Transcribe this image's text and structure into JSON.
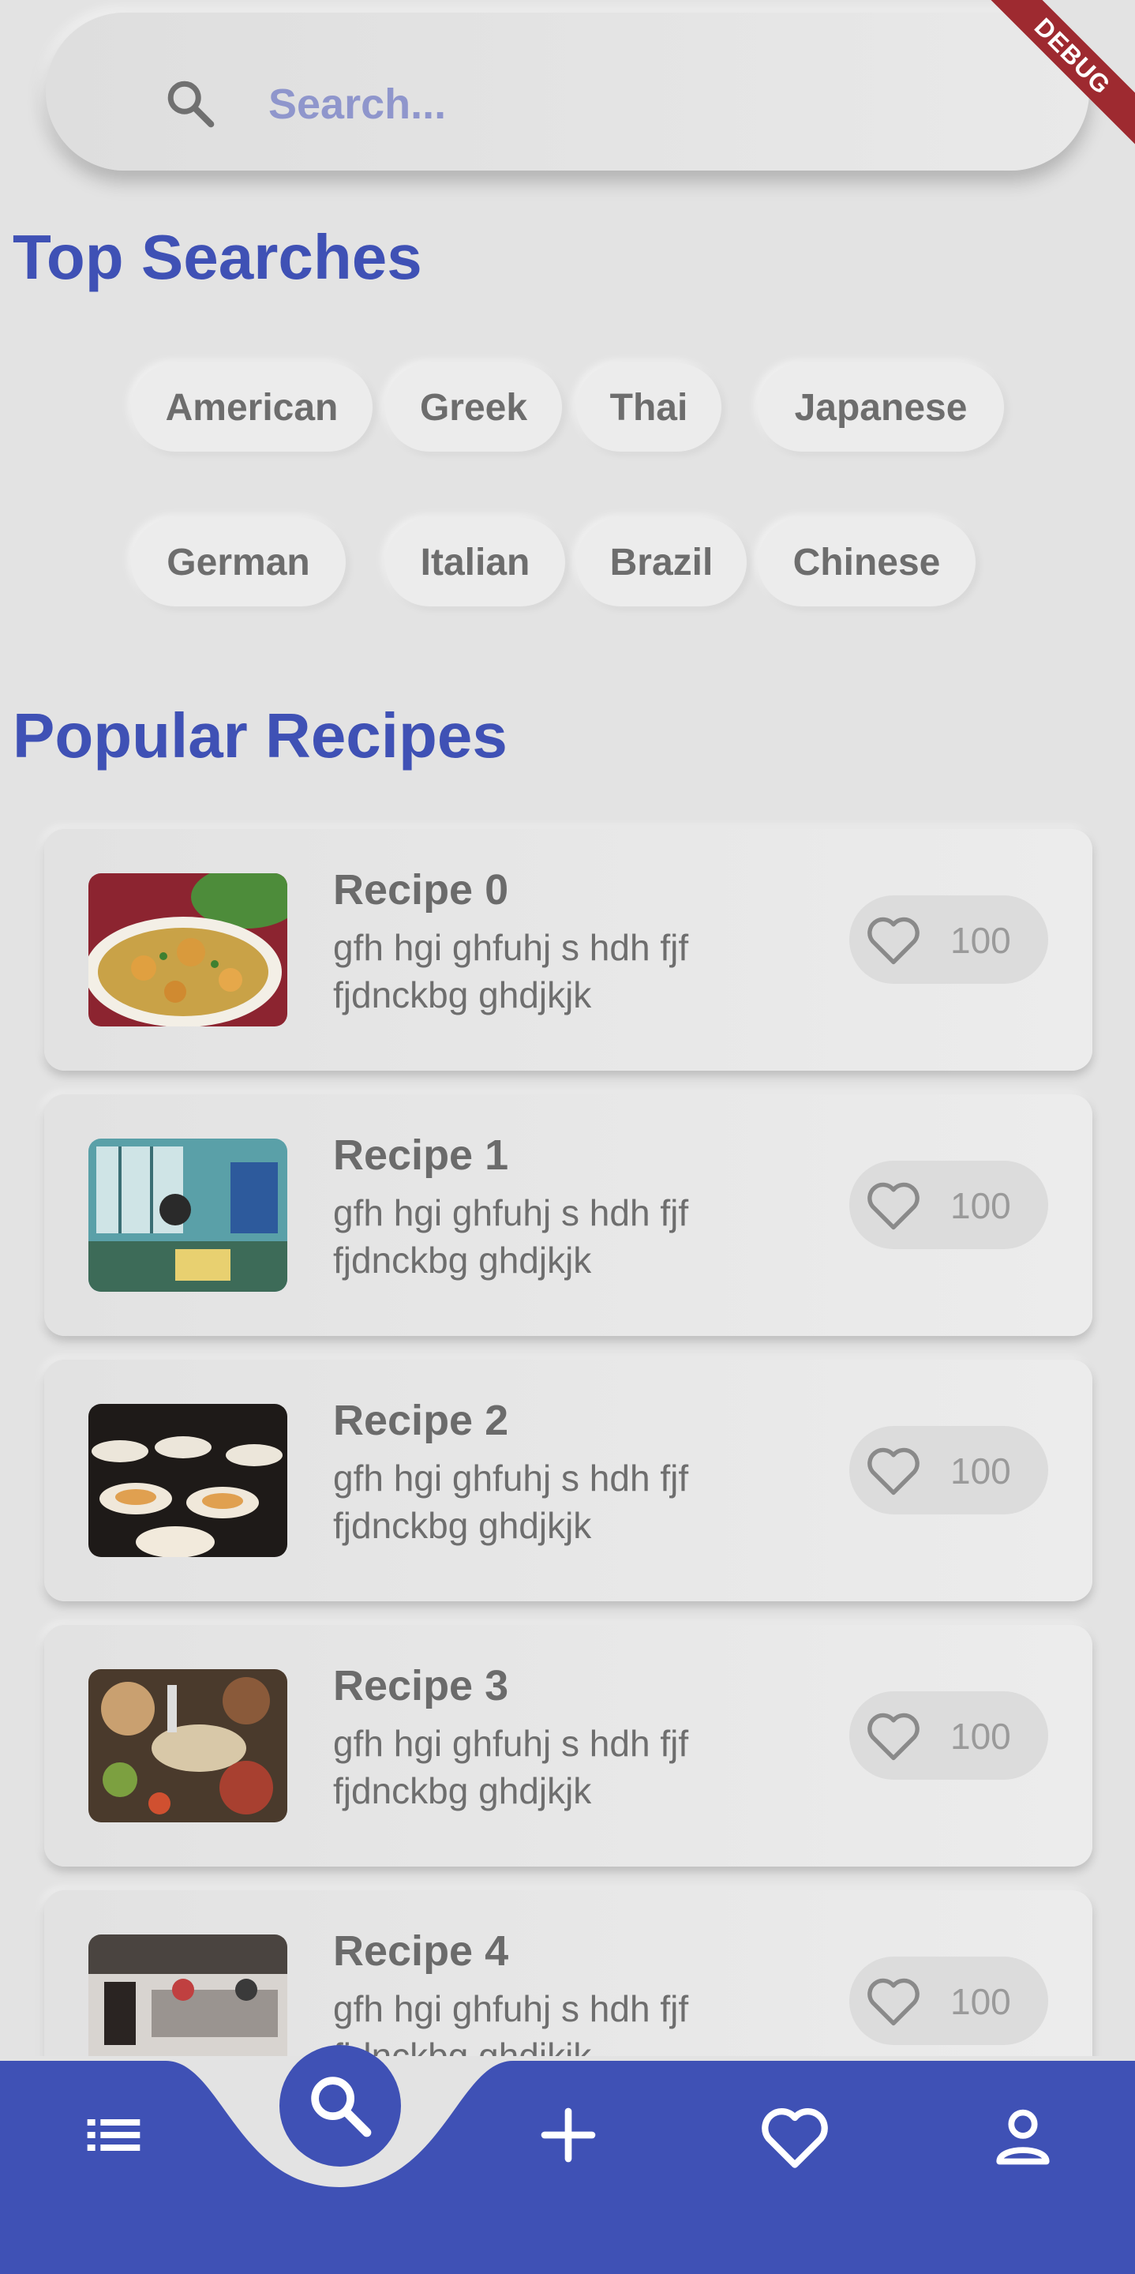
{
  "search": {
    "placeholder": "Search..."
  },
  "debug_label": "DEBUG",
  "top_searches": {
    "title": "Top Searches",
    "tags": [
      "American",
      "Greek",
      "Thai",
      "Japanese",
      "German",
      "Italian",
      "Brazil",
      "Chinese"
    ]
  },
  "popular": {
    "title": "Popular Recipes",
    "recipes": [
      {
        "title": "Recipe 0",
        "description": "gfh hgi ghfuhj s hdh fjf fjdnckbg ghdjkjk",
        "likes": "100"
      },
      {
        "title": "Recipe 1",
        "description": "gfh hgi ghfuhj s hdh fjf fjdnckbg ghdjkjk",
        "likes": "100"
      },
      {
        "title": "Recipe 2",
        "description": "gfh hgi ghfuhj s hdh fjf fjdnckbg ghdjkjk",
        "likes": "100"
      },
      {
        "title": "Recipe 3",
        "description": "gfh hgi ghfuhj s hdh fjf fjdnckbg ghdjkjk",
        "likes": "100"
      },
      {
        "title": "Recipe 4",
        "description": "gfh hgi ghfuhj s hdh fjf fjdnckbg ghdjkjk",
        "likes": "100"
      }
    ]
  },
  "nav": {
    "items": [
      "list-icon",
      "search-icon",
      "plus-icon",
      "heart-icon",
      "person-icon"
    ],
    "active": "search-icon"
  },
  "colors": {
    "accent": "#3f51b5",
    "background": "#e3e3e3",
    "debug": "#9e2a30"
  }
}
